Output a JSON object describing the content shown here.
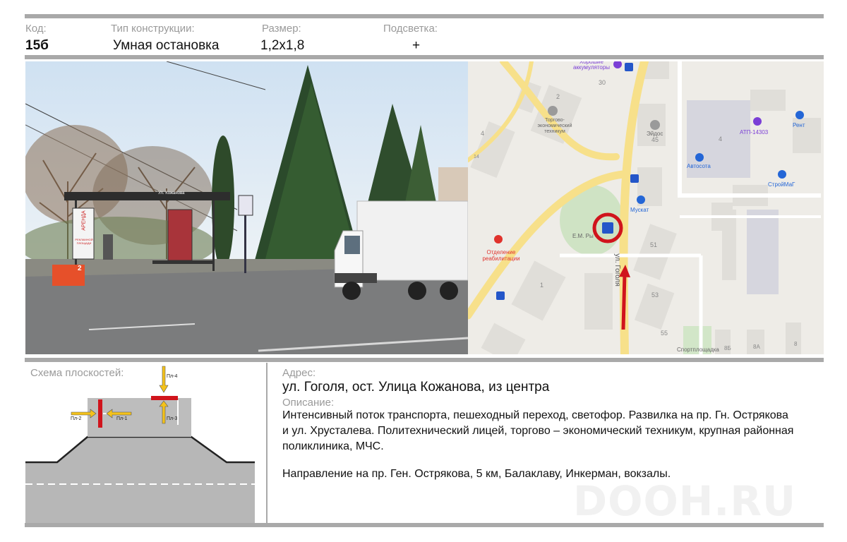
{
  "header": {
    "code_label": "Код:",
    "code_value": "15б",
    "type_label": "Тип конструкции:",
    "type_value": "Умная остановка",
    "size_label": "Размер:",
    "size_value": "1,2х1,8",
    "light_label": "Подсветка:",
    "light_value": "+"
  },
  "photo": {
    "shelter_sign": "Ул. Кожанова",
    "ad_text_1": "АРЕНДА",
    "ad_text_2": "РЕКЛАМНОЙ ПЛОЩАДИ",
    "box_number": "2"
  },
  "map": {
    "labels": {
      "aku": "Хорошие аккумуляторы",
      "n30": "30",
      "n2": "2",
      "tech": "Торгово-экономический техникум",
      "n4a": "4",
      "n14": "14",
      "eidos": "Эйдос",
      "n45": "45",
      "n4b": "4",
      "atp": "АТП-14303",
      "rent": "Рент",
      "avtosota": "Автосота",
      "stroymag": "СтройМаГ",
      "muskat": "Мускат",
      "rybak": "Е.М. Ры",
      "otd": "Отделение реабилитации",
      "street": "ул. Гоголя",
      "n51": "51",
      "n1": "1",
      "n53": "53",
      "n55": "55",
      "sport": "Спортплощадка",
      "n8b": "8Б",
      "n8a": "8А",
      "n8": "8"
    }
  },
  "scheme": {
    "title": "Схема плоскостей:",
    "pl1": "Пл-1",
    "pl2": "Пл-2",
    "pl3": "Пл-3",
    "pl4": "Пл-4"
  },
  "info": {
    "address_label": "Адрес:",
    "address": "ул. Гоголя, ост. Улица Кожанова, из центра",
    "description_label": "Описание:",
    "description_1": "Интенсивный поток транспорта, пешеходный переход, светофор. Развилка на пр. Гн. Острякова",
    "description_2": "и ул. Хрусталева.  Политехнический лицей, торгово – экономический техникум, крупная районная",
    "description_3": "поликлиника, МЧС.",
    "direction": "Направление на пр. Ген. Острякова, 5 км, Балаклаву, Инкерман, вокзалы."
  },
  "watermark": "DOOH.RU",
  "colors": {
    "rule": "#a9a9a9",
    "label": "#9a9a9a",
    "marker": "#d0141c",
    "road_major": "#f7e08a",
    "arrow_yellow": "#f4c21b"
  }
}
